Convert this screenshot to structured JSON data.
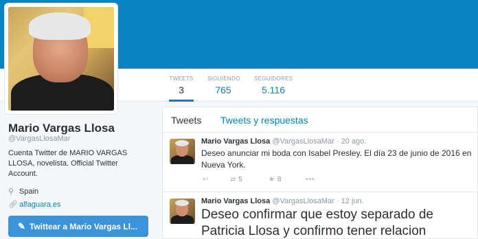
{
  "profile": {
    "name": "Mario Vargas Llosa",
    "handle": "@VargasLlosaMar",
    "bio": "Cuenta Twitter de MARIO VARGAS LLOSA, novelista. Official Twitter Account.",
    "location": "Spain",
    "website": "alfaguara.es",
    "tweet_to_label": "Twittear a Mario Vargas Ll..."
  },
  "stats": {
    "tweets_label": "TWEETS",
    "tweets_value": "3",
    "following_label": "SIGUIENDO",
    "following_value": "765",
    "followers_label": "SEGUIDORES",
    "followers_value": "5.116"
  },
  "tabs": {
    "tweets": "Tweets",
    "replies": "Tweets y respuestas"
  },
  "tweets": [
    {
      "name": "Mario Vargas Llosa",
      "handle": "@VargasLlosaMar",
      "time": "20 ago.",
      "text": "Deseo anunciar mi boda con Isabel Presley. El día 23 de junio de 2016 en Nueva York.",
      "retweets": "5",
      "favorites": "8"
    },
    {
      "name": "Mario Vargas Llosa",
      "handle": "@VargasLlosaMar",
      "time": "12 jun.",
      "text": "Deseo confirmar que estoy separado de Patricia Llosa y confirmo tener relacion"
    }
  ],
  "colors": {
    "banner": "#0a84c0",
    "accent": "#0084b4",
    "button": "#3b94d9"
  },
  "icons": {
    "location": "map-pin-icon",
    "link": "link-icon",
    "compose": "compose-icon",
    "reply": "reply-icon",
    "retweet": "retweet-icon",
    "favorite": "star-icon",
    "more": "more-icon"
  }
}
